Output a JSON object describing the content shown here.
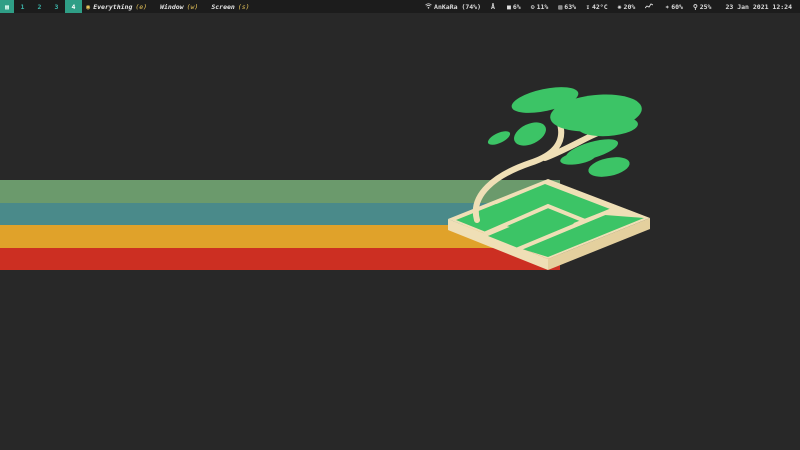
{
  "topbar": {
    "workspaces": [
      {
        "label": "▦",
        "icon": "app-launcher-icon"
      },
      {
        "label": "1"
      },
      {
        "label": "2"
      },
      {
        "label": "3"
      },
      {
        "label": "4",
        "active": true
      }
    ],
    "screenshot_actions": [
      {
        "label": "Everything",
        "key": "(e)",
        "icon": "camera-icon"
      },
      {
        "label": "Window",
        "key": "(w)"
      },
      {
        "label": "Screen",
        "key": "(s)"
      }
    ],
    "status": {
      "wifi": {
        "icon": "wifi-icon",
        "text": "AnKaRa (74%)"
      },
      "bluetooth": {
        "icon": "bluetooth-icon",
        "text": ""
      },
      "cpu": {
        "icon": "cpu-icon",
        "text": "6%"
      },
      "memory": {
        "icon": "memory-icon",
        "text": "11%"
      },
      "disk": {
        "icon": "disk-icon",
        "text": "63%"
      },
      "temperature": {
        "icon": "thermometer-icon",
        "text": "42°C"
      },
      "fan": {
        "icon": "fan-icon",
        "text": "20%"
      },
      "network": {
        "icon": "network-activity-icon",
        "text": ""
      },
      "brightness": {
        "icon": "brightness-icon",
        "text": "60%"
      },
      "volume": {
        "icon": "microphone-icon",
        "text": "25%"
      },
      "datetime": "23 Jan 2021 12:24"
    }
  },
  "wallpaper": {
    "stripe_colors": [
      "#6b9a6c",
      "#4a8a8a",
      "#e0a22a",
      "#cc2f22"
    ],
    "leaf_color": "#3cc466",
    "cream_color": "#efdfb6",
    "background": "#282828"
  }
}
